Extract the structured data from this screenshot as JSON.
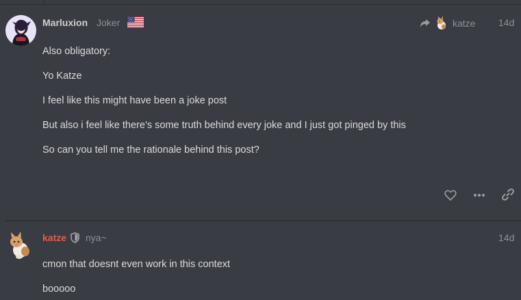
{
  "posts": [
    {
      "username": "Marluxion",
      "title": "Joker",
      "reply_to": "katze",
      "date": "14d",
      "paragraphs": [
        "Also obligatory:",
        "Yo Katze",
        "I feel like this might have been a joke post",
        "But also i feel like there’s some truth behind every joke and I just got pinged by this",
        "So can you tell me the rationale behind this post?"
      ],
      "actions": [
        "heart-icon",
        "more-icon",
        "link-icon"
      ]
    },
    {
      "username": "katze",
      "title": "nya~",
      "date": "14d",
      "paragraphs": [
        "cmon that doesnt even work in this context",
        "booooo"
      ]
    }
  ],
  "colors": {
    "background": "#3a3c43",
    "username_red": "#e45c4c",
    "muted": "#8e9096",
    "text": "#dcdcdc"
  }
}
